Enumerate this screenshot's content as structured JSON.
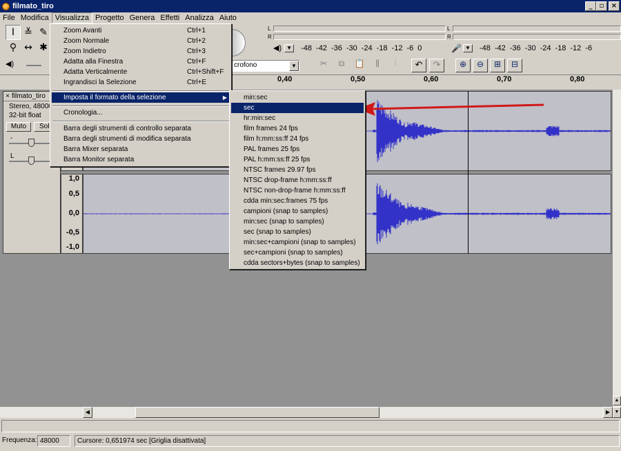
{
  "window": {
    "title": "filmato_tiro"
  },
  "menubar": [
    "File",
    "Modifica",
    "Visualizza",
    "Progetto",
    "Genera",
    "Effetti",
    "Analizza",
    "Aiuto"
  ],
  "view_menu": {
    "items": [
      {
        "label": "Zoom Avanti",
        "shortcut": "Ctrl+1"
      },
      {
        "label": "Zoom Normale",
        "shortcut": "Ctrl+2"
      },
      {
        "label": "Zoom Indietro",
        "shortcut": "Ctrl+3"
      },
      {
        "label": "Adatta alla Finestra",
        "shortcut": "Ctrl+F"
      },
      {
        "label": "Adatta Verticalmente",
        "shortcut": "Ctrl+Shift+F"
      },
      {
        "label": "Ingrandisci la Selezione",
        "shortcut": "Ctrl+E"
      },
      {
        "label": "Imposta il formato della selezione",
        "shortcut": ""
      },
      {
        "label": "Cronologia...",
        "shortcut": ""
      },
      {
        "label": "Barra degli strumenti di controllo separata",
        "shortcut": ""
      },
      {
        "label": "Barra degli strumenti di modifica separata",
        "shortcut": ""
      },
      {
        "label": "Barra Mixer separata",
        "shortcut": ""
      },
      {
        "label": "Barra Monitor separata",
        "shortcut": ""
      }
    ]
  },
  "format_submenu": {
    "items": [
      "min:sec",
      "sec",
      "hr:min:sec",
      "film frames 24 fps",
      "film h:mm:ss:ff 24 fps",
      "PAL frames 25 fps",
      "PAL h:mm:ss:ff 25 fps",
      "NTSC frames 29.97 fps",
      "NTSC drop-frame h:mm:ss:ff",
      "NTSC non-drop-frame h:mm:ss:ff",
      "cdda min:sec:frames 75 fps",
      "campioni (snap to samples)",
      "min:sec (snap to samples)",
      "sec (snap to samples)",
      "min:sec+campioni (snap to samples)",
      "sec+campioni (snap to samples)",
      "cdda sectors+bytes (snap to samples)"
    ],
    "selected": "sec"
  },
  "meters": {
    "play_scale": [
      "-48",
      "-42",
      "-36",
      "-30",
      "-24",
      "-18",
      "-12",
      "-6",
      "0"
    ],
    "rec_scale": [
      "-48",
      "-42",
      "-36",
      "-30",
      "-24",
      "-18",
      "-12",
      "-6"
    ],
    "l": "L",
    "r": "R"
  },
  "input_source": "crofono",
  "ruler": [
    "0,40",
    "0,50",
    "0,60",
    "0,70",
    "0,80"
  ],
  "track": {
    "name": "filmato_tiro",
    "info1": "Stereo, 48000",
    "info2": "32-bit float",
    "mute": "Muto",
    "solo": "Solo",
    "gain_label": "-",
    "pan_label": "L",
    "scale": [
      "1,0",
      "0,5",
      "0,0",
      "-0,5",
      "-1,0"
    ]
  },
  "status": {
    "rate_label": "Frequenza:",
    "rate_value": "48000",
    "cursor": "Cursore: 0,651974 sec  [Griglia disattivata]"
  },
  "colors": {
    "titlebar": "#0a246a",
    "waveform": "#3232c8",
    "annotation_arrow": "#d01818"
  }
}
